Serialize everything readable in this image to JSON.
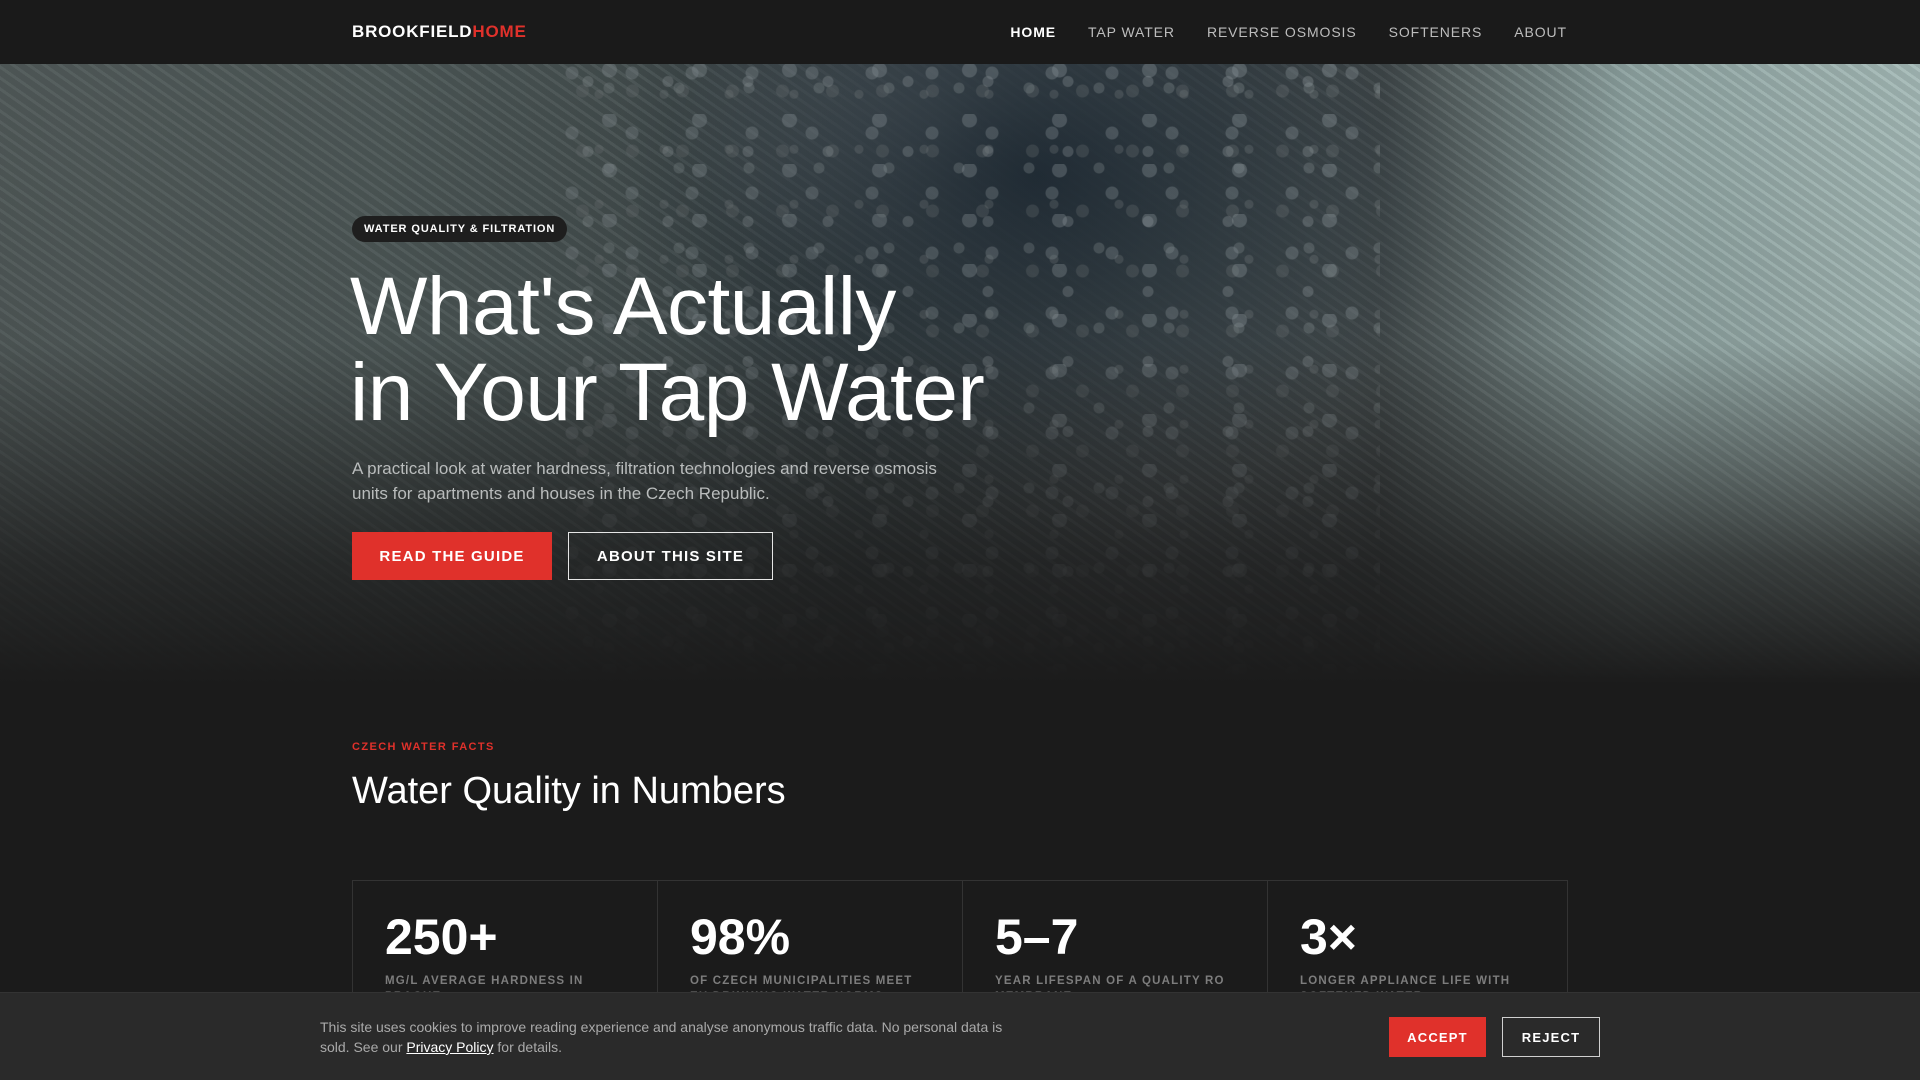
{
  "brand": {
    "part1": "BROOKFIELD",
    "part2": "HOME",
    "accent_color": "#e0312b"
  },
  "nav": {
    "items": [
      {
        "label": "HOME",
        "active": true
      },
      {
        "label": "TAP WATER",
        "active": false
      },
      {
        "label": "REVERSE OSMOSIS",
        "active": false
      },
      {
        "label": "SOFTENERS",
        "active": false
      },
      {
        "label": "ABOUT",
        "active": false
      }
    ]
  },
  "hero": {
    "badge": "WATER QUALITY & FILTRATION",
    "title_line1": "What's Actually",
    "title_line2": "in Your Tap Water",
    "subtitle": "A practical look at water hardness, filtration technologies and reverse osmosis units for apartments and houses in the Czech Republic.",
    "primary_button": "READ THE GUIDE",
    "secondary_button": "ABOUT THIS SITE"
  },
  "facts": {
    "eyebrow": "CZECH WATER FACTS",
    "title": "Water Quality in Numbers",
    "stats": [
      {
        "value": "250+",
        "label": "MG/L AVERAGE HARDNESS IN PRAGUE"
      },
      {
        "value": "98%",
        "label": "OF CZECH MUNICIPALITIES MEET EU DRINKING WATER NORMS"
      },
      {
        "value": "5–7",
        "label": "YEAR LIFESPAN OF A QUALITY RO MEMBRANE"
      },
      {
        "value": "3×",
        "label": "LONGER APPLIANCE LIFE WITH SOFTENED WATER"
      }
    ]
  },
  "cookie": {
    "text_before": "This site uses cookies to improve reading experience and analyse anonymous traffic data. No personal data is sold. See our",
    "link": "Privacy Policy",
    "text_after": "for details.",
    "accept": "ACCEPT",
    "reject": "REJECT"
  }
}
